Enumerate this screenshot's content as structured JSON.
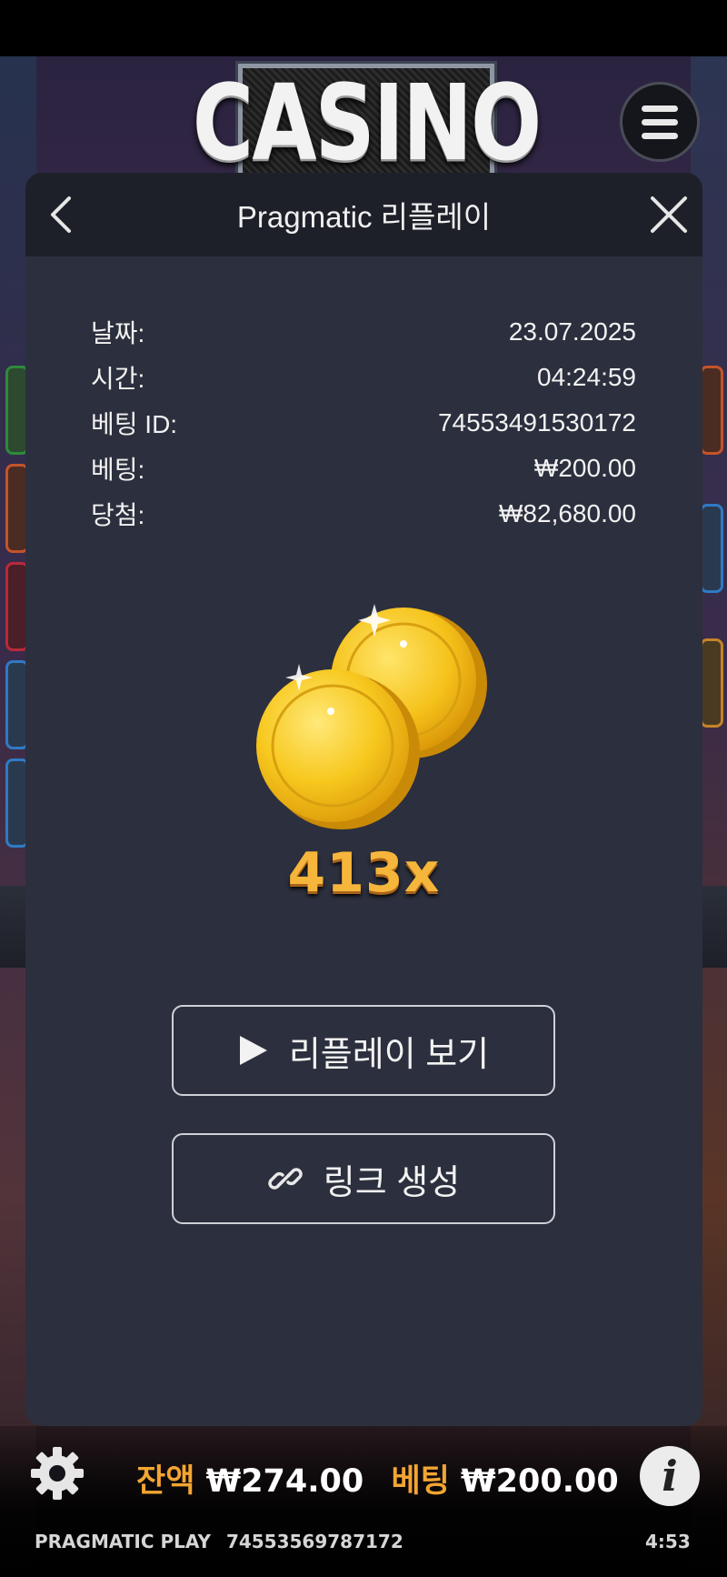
{
  "game": {
    "logo_text": "CASINO"
  },
  "panel": {
    "title": "Pragmatic 리플레이",
    "info": [
      {
        "label": "날짜:",
        "value": "23.07.2025"
      },
      {
        "label": "시간:",
        "value": "04:24:59"
      },
      {
        "label": "베팅 ID:",
        "value": "74553491530172"
      },
      {
        "label": "베팅:",
        "value": "₩200.00"
      },
      {
        "label": "당첨:",
        "value": "₩82,680.00"
      }
    ],
    "multiplier": "413x",
    "replay_button_label": "리플레이 보기",
    "link_button_label": "링크 생성"
  },
  "bottom_bar": {
    "balance_label": "잔액",
    "balance_value": "₩274.00",
    "bet_label": "베팅",
    "bet_value": "₩200.00",
    "provider": "PRAGMATIC PLAY",
    "round_id": "74553569787172",
    "time": "4:53"
  },
  "colors": {
    "panel_bg": "#2c2f3d",
    "panel_header_bg": "#1e2029",
    "accent_orange": "#f3a532",
    "coin_gold": "#f5c21a"
  },
  "icons": {
    "menu": "hamburger-icon",
    "back": "chevron-left-icon",
    "close": "close-icon",
    "play": "play-icon",
    "link": "link-icon",
    "settings": "gear-icon",
    "info": "info-icon"
  }
}
